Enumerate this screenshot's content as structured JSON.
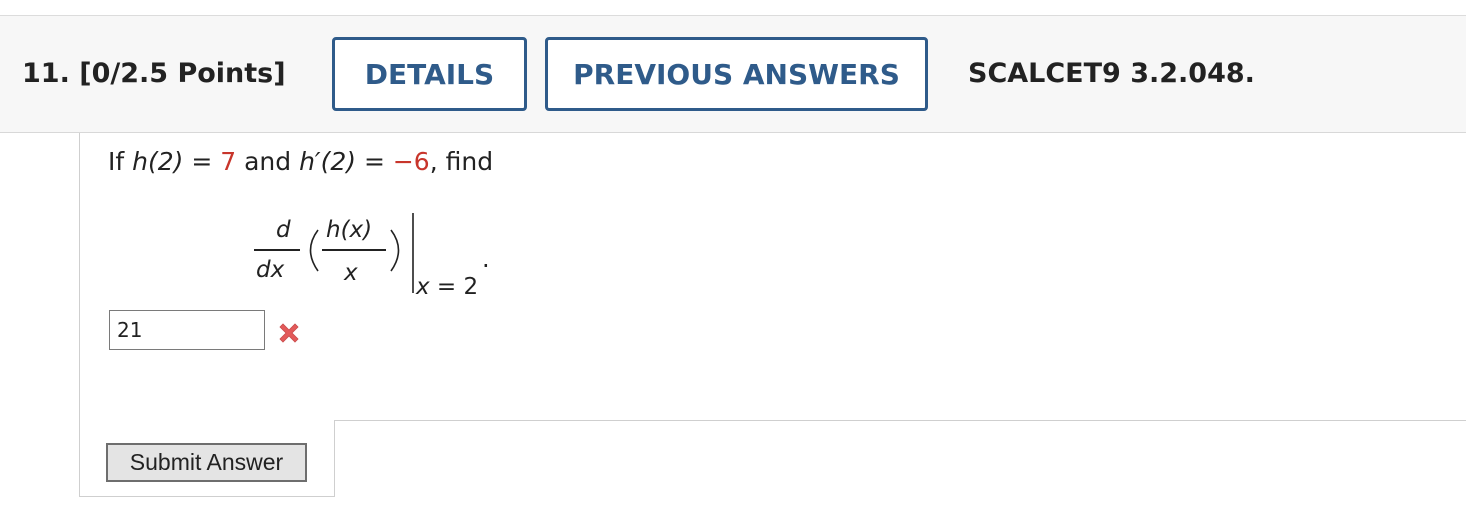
{
  "header": {
    "question_label": "11. [0/2.5 Points]",
    "details_button": "DETAILS",
    "previous_answers_button": "PREVIOUS ANSWERS",
    "reference": "SCALCET9 3.2.048."
  },
  "problem": {
    "if": "If ",
    "h2_lhs": "h(2)",
    "eq1": " = ",
    "h2_value": "7",
    "and": " and ",
    "hp2_lhs": "h′(2)",
    "eq2": " = ",
    "hp2_value": "−6",
    "find": ", find"
  },
  "expression": {
    "numerator_d": "d",
    "denominator_dx": "dx",
    "fraction_numerator": "h(x)",
    "fraction_denominator": "x",
    "eval_var": "x",
    "eval_rest": " = 2",
    "period": "."
  },
  "answer": {
    "value": "21",
    "status": "incorrect",
    "status_icon": "x-mark-icon",
    "status_color": "#e35a5a"
  },
  "submit_button": "Submit Answer",
  "colors": {
    "accent": "#2f5b8a",
    "given_values": "#c8352b"
  }
}
